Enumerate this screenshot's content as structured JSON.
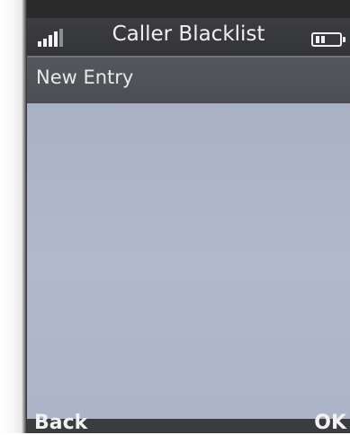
{
  "header": {
    "title": "Caller Blacklist",
    "signal_icon": "signal-strength-icon",
    "battery_icon": "battery-icon"
  },
  "list": {
    "items": [
      {
        "label": "New Entry"
      }
    ]
  },
  "softkeys": {
    "left": "Back",
    "right": "OK"
  },
  "colors": {
    "header_bg": "#37383b",
    "highlight_bg": "#505257",
    "content_bg": "#aeb6c9",
    "text": "#f0f0f0"
  }
}
